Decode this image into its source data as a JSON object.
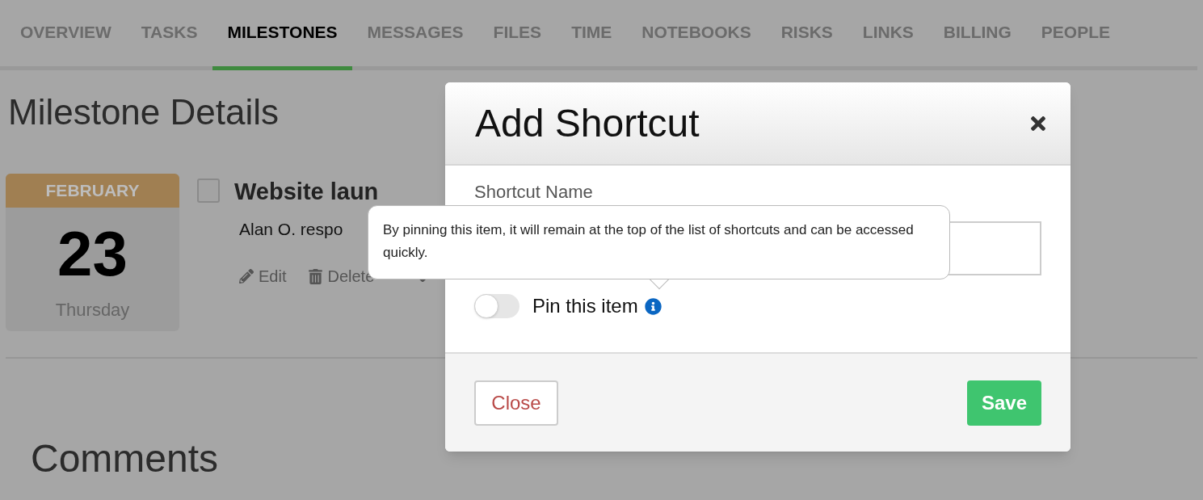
{
  "tabs": [
    {
      "label": "OVERVIEW",
      "selected": false
    },
    {
      "label": "TASKS",
      "selected": false
    },
    {
      "label": "MILESTONES",
      "selected": true
    },
    {
      "label": "MESSAGES",
      "selected": false
    },
    {
      "label": "FILES",
      "selected": false
    },
    {
      "label": "TIME",
      "selected": false
    },
    {
      "label": "NOTEBOOKS",
      "selected": false
    },
    {
      "label": "RISKS",
      "selected": false
    },
    {
      "label": "LINKS",
      "selected": false
    },
    {
      "label": "BILLING",
      "selected": false
    },
    {
      "label": "PEOPLE",
      "selected": false
    }
  ],
  "page_title": "Milestone Details",
  "milestone": {
    "month": "FEBRUARY",
    "day": "23",
    "weekday": "Thursday",
    "checked": false,
    "title": "Website laun",
    "responsible": "Alan O. respo",
    "actions": [
      "Edit",
      "Delete"
    ]
  },
  "comments_title": "Comments",
  "dialog": {
    "title": "Add Shortcut",
    "field_label": "Shortcut Name",
    "pin": {
      "label": "Pin this item",
      "on": false
    },
    "tooltip": "By pinning this item, it will remain at the top of the list of shortcuts and can be accessed quickly.",
    "buttons": [
      "Close",
      "Save"
    ]
  }
}
